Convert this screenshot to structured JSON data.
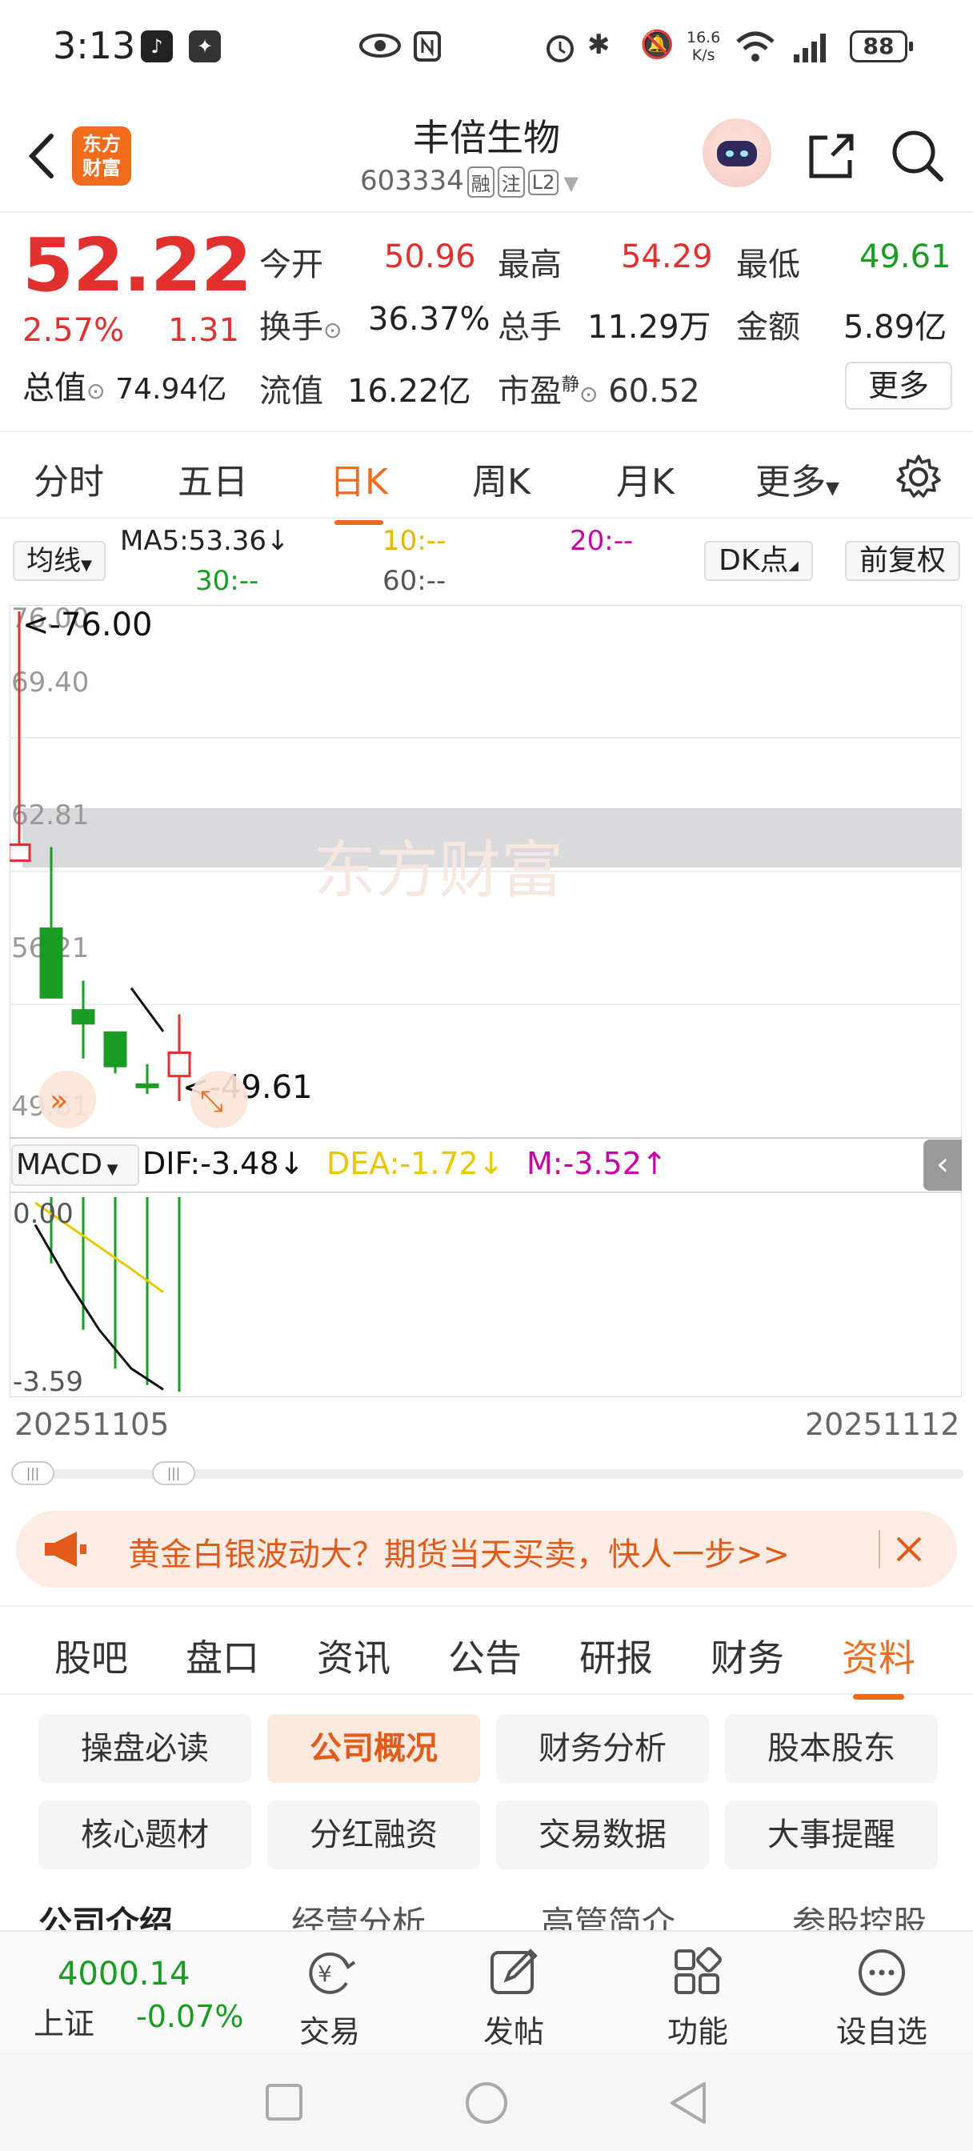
{
  "status_bar": {
    "time": "3:13",
    "net_speed_value": "16.6",
    "net_speed_unit": "K/s",
    "battery": "88",
    "icons": [
      "tiktok-icon",
      "app-icon",
      "eye-icon",
      "nfc-icon",
      "alarm-icon",
      "bluetooth-icon",
      "mute-icon",
      "wifi-icon",
      "signal-icon",
      "battery-icon"
    ]
  },
  "header": {
    "app_logo_line1": "东方",
    "app_logo_line2": "财富",
    "stock_name": "丰倍生物",
    "stock_code": "603334",
    "tags": [
      "融",
      "注",
      "L2"
    ]
  },
  "quote": {
    "price": "52.22",
    "change_pct": "2.57%",
    "change_amt": "1.31",
    "market_value_label": "总值",
    "market_value": "74.94亿",
    "open_label": "今开",
    "open": "50.96",
    "high_label": "最高",
    "high": "54.29",
    "low_label": "最低",
    "low": "49.61",
    "turnover_label": "换手",
    "turnover": "36.37%",
    "volume_label": "总手",
    "volume": "11.29万",
    "amount_label": "金额",
    "amount": "5.89亿",
    "float_label": "流值",
    "float_value": "16.22亿",
    "pe_label": "市盈",
    "pe_sup": "静",
    "pe": "60.52",
    "more_label": "更多",
    "colors": {
      "up": "#e0312f",
      "down": "#1a9c22"
    }
  },
  "period_tabs": {
    "items": [
      "分时",
      "五日",
      "日K",
      "周K",
      "月K",
      "更多"
    ],
    "active": "日K"
  },
  "ma_bar": {
    "selector": "均线",
    "ma5": "MA5:53.36",
    "ma5_arrow": "↓",
    "ma10": "10:--",
    "ma20": "20:--",
    "ma30": "30:--",
    "ma60": "60:--",
    "dk_label": "DK点",
    "adjust_label": "前复权"
  },
  "chart_data": {
    "type": "candlestick",
    "y_ticks": [
      "76.00",
      "69.40",
      "62.81",
      "56.21",
      "49.61"
    ],
    "ylim": [
      49.61,
      76.0
    ],
    "max_marker": "<-76.00",
    "min_marker": "<-49.61",
    "watermark": "东方财富",
    "candles": [
      {
        "open": 63.0,
        "close": 63.0,
        "high": 76.0,
        "low": 63.0,
        "color": "red"
      },
      {
        "open": 58.9,
        "close": 55.2,
        "high": 63.3,
        "low": 55.2,
        "color": "green"
      },
      {
        "open": 54.5,
        "close": 53.8,
        "high": 56.1,
        "low": 51.9,
        "color": "green"
      },
      {
        "open": 53.3,
        "close": 51.5,
        "high": 53.3,
        "low": 51.1,
        "color": "green"
      },
      {
        "open": 50.5,
        "close": 50.5,
        "high": 51.6,
        "low": 50.0,
        "color": "green"
      },
      {
        "open": 50.96,
        "close": 52.22,
        "high": 54.29,
        "low": 49.61,
        "color": "red"
      }
    ],
    "ma5_segment": [
      {
        "candle": 4,
        "value": 55.7
      },
      {
        "candle": 5,
        "value": 53.36
      }
    ]
  },
  "macd": {
    "selector": "MACD",
    "dif": "DIF:-3.48",
    "dif_arrow": "↓",
    "dea": "DEA:-1.72",
    "dea_arrow": "↓",
    "m": "M:-3.52",
    "m_arrow": "↑",
    "top_tick": "0.00",
    "bottom_tick": "-3.59",
    "ylim": [
      -3.59,
      0.0
    ],
    "bars": [
      -1.2,
      -2.4,
      -3.1,
      -3.4,
      -3.52
    ],
    "dif_values": [
      -0.5,
      -1.5,
      -2.4,
      -3.1,
      -3.48
    ],
    "dea_values": [
      -0.1,
      -0.5,
      -0.9,
      -1.3,
      -1.72
    ]
  },
  "date_range": {
    "start": "20251105",
    "end": "20251112"
  },
  "ad_banner": {
    "text": "黄金白银波动大？期货当天买卖，快人一步>>"
  },
  "info_tabs": {
    "items": [
      "股吧",
      "盘口",
      "资讯",
      "公告",
      "研报",
      "财务",
      "资料"
    ],
    "active": "资料"
  },
  "profile_buttons": {
    "items": [
      "操盘必读",
      "公司概况",
      "财务分析",
      "股本股东",
      "核心题材",
      "分红融资",
      "交易数据",
      "大事提醒"
    ],
    "active": "公司概况"
  },
  "section_tabs": [
    "公司介绍",
    "经营分析",
    "高管简介",
    "参股控股"
  ],
  "bottom_nav": {
    "index_value": "4000.14",
    "index_name": "上证",
    "index_change": "-0.07%",
    "items": [
      "交易",
      "发帖",
      "功能",
      "设自选"
    ]
  }
}
